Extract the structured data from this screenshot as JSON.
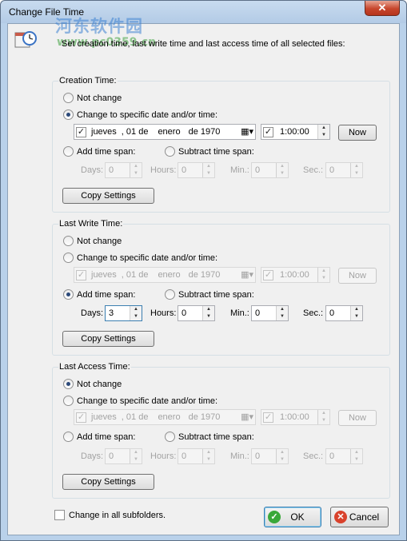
{
  "window": {
    "title": "Change File Time",
    "close_glyph": "✕"
  },
  "watermark": {
    "site": "河东软件园",
    "url": "www.pc0359.cn"
  },
  "intro": "Set creation time, last write time and last access time of all selected files:",
  "options": {
    "not_change": "Not change",
    "specific": "Change to specific date and/or time:",
    "add_span": "Add time span:",
    "sub_span": "Subtract time span:",
    "days": "Days:",
    "hours": "Hours:",
    "min": "Min.:",
    "sec": "Sec.:",
    "now": "Now",
    "copy": "Copy Settings"
  },
  "date": {
    "day": "jueves",
    "sep": ", 01 de",
    "month": "enero",
    "year": "de 1970",
    "time": "1:00:00"
  },
  "creation": {
    "label": "Creation Time:",
    "mode": "specific",
    "days": "0",
    "hours": "0",
    "min": "0",
    "sec": "0"
  },
  "lastwrite": {
    "label": "Last Write Time:",
    "mode": "add",
    "days": "3",
    "hours": "0",
    "min": "0",
    "sec": "0"
  },
  "lastaccess": {
    "label": "Last Access Time:",
    "mode": "not_change",
    "days": "0",
    "hours": "0",
    "min": "0",
    "sec": "0"
  },
  "footer": {
    "subfolders": "Change in all subfolders.",
    "ok": "OK",
    "cancel": "Cancel"
  },
  "colors": {
    "ok_icon": "#3aa83a",
    "cancel_icon": "#d9412b",
    "title_bar": "#b9d1ea"
  }
}
